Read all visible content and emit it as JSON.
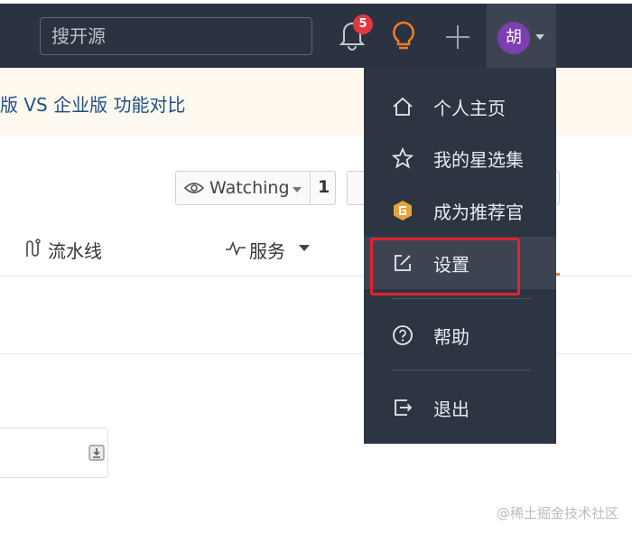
{
  "header": {
    "search_placeholder": "搜开源",
    "notification_count": "5",
    "avatar_text": "胡"
  },
  "banner": {
    "text": "版 VS 企业版 功能对比"
  },
  "repo_actions": {
    "watch_label": "Watching",
    "watch_count": "1"
  },
  "tabs": [
    {
      "label": "流水线",
      "icon": "pipeline-icon"
    },
    {
      "label": "服务",
      "icon": "pulse-icon"
    }
  ],
  "user_menu": {
    "items": [
      {
        "label": "个人主页",
        "icon": "home-icon"
      },
      {
        "label": "我的星选集",
        "icon": "star-icon"
      },
      {
        "label": "成为推荐官",
        "icon": "gitee-hexagon-icon"
      },
      {
        "label": "设置",
        "icon": "edit-icon"
      },
      {
        "label": "帮助",
        "icon": "help-circle-icon"
      },
      {
        "label": "退出",
        "icon": "logout-icon"
      }
    ]
  },
  "watermark": "@稀土掘金技术社区",
  "colors": {
    "topbar": "#2c3340",
    "menu": "#2e3542",
    "highlight": "#e4222e",
    "badge": "#e0393e",
    "avatar": "#7b3fb0",
    "bulb": "#f27d22"
  }
}
